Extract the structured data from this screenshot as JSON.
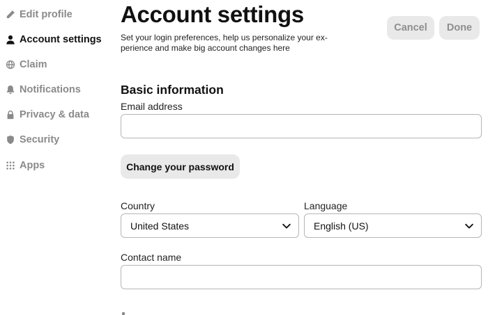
{
  "sidebar": {
    "items": [
      {
        "label": "Edit profile",
        "icon": "pencil-icon",
        "active": false
      },
      {
        "label": "Account settings",
        "icon": "person-icon",
        "active": true
      },
      {
        "label": "Claim",
        "icon": "globe-icon",
        "active": false
      },
      {
        "label": "Notifications",
        "icon": "bell-icon",
        "active": false
      },
      {
        "label": "Privacy & data",
        "icon": "lock-icon",
        "active": false
      },
      {
        "label": "Security",
        "icon": "shield-icon",
        "active": false
      },
      {
        "label": "Apps",
        "icon": "grid-icon",
        "active": false
      }
    ]
  },
  "header": {
    "title": "Account settings",
    "subtitle": "Set your login preferences, help us personalize your ex-perience and make big account changes here",
    "cancel_label": "Cancel",
    "done_label": "Done"
  },
  "main": {
    "section_heading": "Basic information",
    "email": {
      "label": "Email address",
      "value": ""
    },
    "change_password_label": "Change your password",
    "country": {
      "label": "Country",
      "value": "United States"
    },
    "language": {
      "label": "Language",
      "value": "English (US)"
    },
    "contact_name": {
      "label": "Contact name",
      "value": ""
    }
  },
  "colors": {
    "active_text": "#111111",
    "inactive_text": "#8a8a8a",
    "button_bg": "#e9e9e9",
    "input_border": "#b5b5b5"
  }
}
